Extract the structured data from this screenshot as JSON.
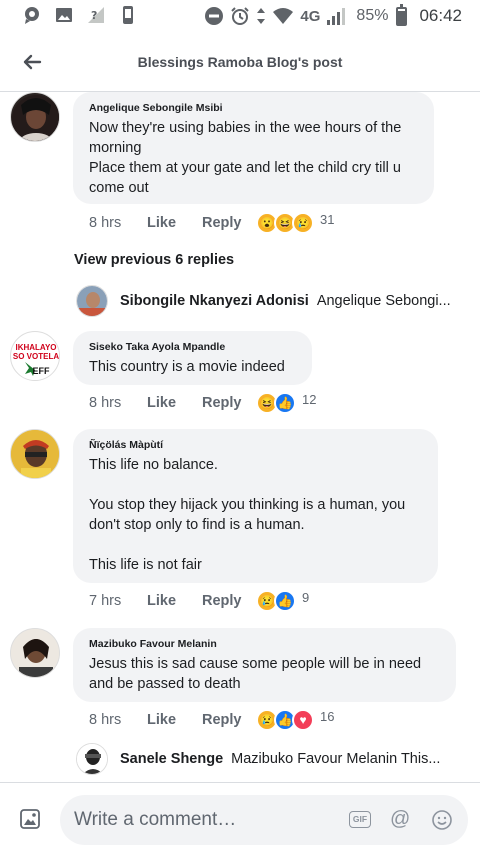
{
  "status_bar": {
    "network": "4G",
    "battery_percent": "85%",
    "battery_level": 0.85,
    "time": "06:42",
    "icons_left": [
      "chat-bubble-icon",
      "gallery-icon",
      "signal-question-icon",
      "phone-icon"
    ],
    "icons_right": [
      "do-not-disturb-icon",
      "alarm-icon",
      "data-arrows-icon",
      "wifi-icon",
      "cell-signal-icon",
      "battery-icon"
    ]
  },
  "header": {
    "title": "Blessings Ramoba Blog's post",
    "back_icon": "back-arrow-icon"
  },
  "comments": [
    {
      "author": "Angelique Sebongile Msibi",
      "text": "Now they're using babies in the wee hours of the\nmorning\nPlace them at your gate and let the child cry till u\ncome out",
      "time": "8 hrs",
      "like": "Like",
      "reply": "Reply",
      "reactions": [
        "wow",
        "haha",
        "sad"
      ],
      "count": "31"
    },
    {
      "author": "Siseko Taka Ayola Mpandle",
      "text": "This country is a movie indeed",
      "time": "8 hrs",
      "like": "Like",
      "reply": "Reply",
      "reactions": [
        "haha",
        "like"
      ],
      "count": "12"
    },
    {
      "author": "Ñïçölás Màpùtí",
      "text": "This life no balance.\n\nYou stop they hijack you thinking is a human, you\ndon't stop only to find is a human.\n\nThis life is not fair",
      "time": "7 hrs",
      "like": "Like",
      "reply": "Reply",
      "reactions": [
        "sad",
        "like"
      ],
      "count": "9"
    },
    {
      "author": "Mazibuko Favour Melanin",
      "text": "Jesus this is sad cause some people will be in need\nand be passed to death",
      "time": "8 hrs",
      "like": "Like",
      "reply": "Reply",
      "reactions": [
        "sad",
        "like",
        "love"
      ],
      "count": "16"
    }
  ],
  "view_previous": "View previous 6 replies",
  "reply_previews": [
    {
      "name": "Sibongile Nkanyezi Adonisi",
      "text": "Angelique Sebongi..."
    },
    {
      "name": "Sanele Shenge",
      "text": "Mazibuko Favour Melanin  This..."
    }
  ],
  "avatar_badge": {
    "line1": "IKHALAYO",
    "line2": "SO VOTELA",
    "line3": "EFF"
  },
  "composer": {
    "placeholder": "Write a comment…",
    "gif_label": "GIF",
    "at_label": "@"
  },
  "colors": {
    "bubble": "#f2f3f5",
    "like_blue": "#1877f2",
    "love_red": "#f33e58",
    "emoji_yellow": "#f7b125"
  }
}
